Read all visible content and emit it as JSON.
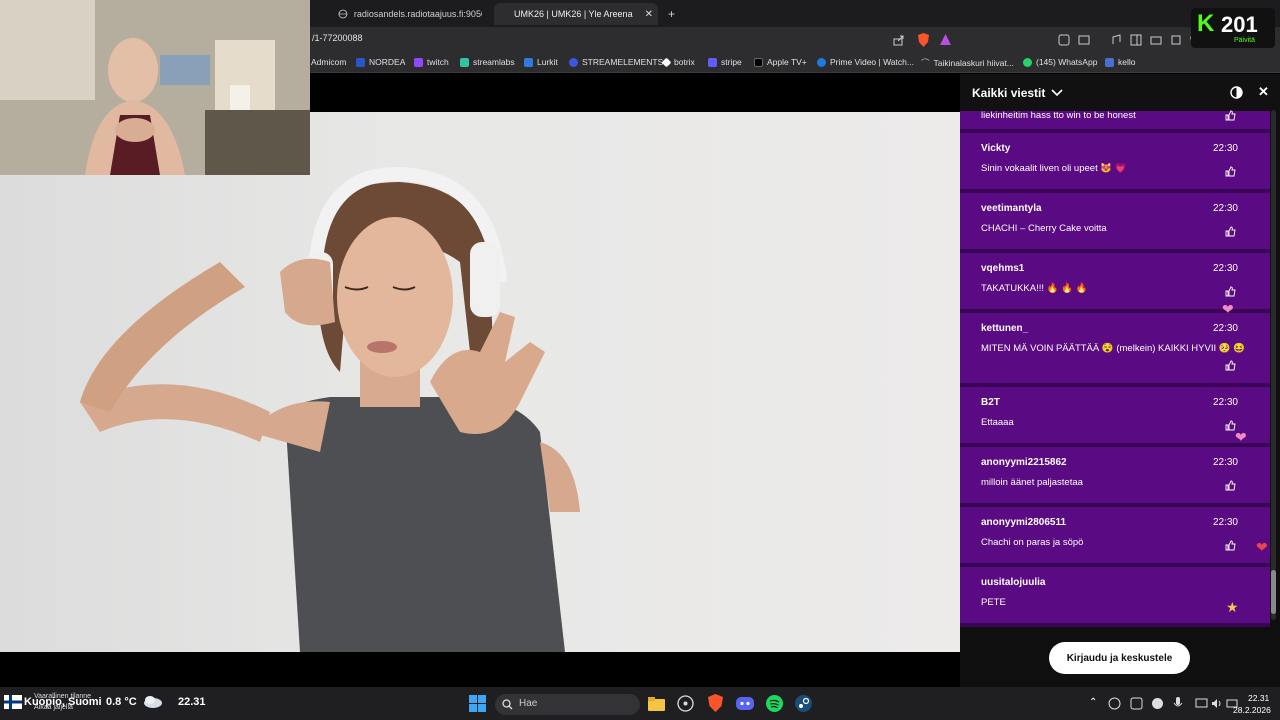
{
  "browser": {
    "tabs": [
      {
        "label": "radiosandels.radiotaajuus.fi:9050/rad"
      },
      {
        "label": "UMK26 | UMK26 | Yle Areena"
      }
    ],
    "new_tab": "+",
    "url": "/1-77200088",
    "bookmarks": [
      {
        "label": "Admicom",
        "color": "#ffffff"
      },
      {
        "label": "NORDEA",
        "color": "#2b56c9"
      },
      {
        "label": "twitch",
        "color": "#9146ff"
      },
      {
        "label": "streamlabs",
        "color": "#31c3a2"
      },
      {
        "label": "Lurkit",
        "color": "#2f7be0"
      },
      {
        "label": "STREAMELEMENTS",
        "color": "#3c55e3"
      },
      {
        "label": "botrix",
        "color": "#ffffff"
      },
      {
        "label": "stripe",
        "color": "#635bff"
      },
      {
        "label": "Apple TV+",
        "color": "#000000"
      },
      {
        "label": "Prime Video | Watch...",
        "color": "#1f7ae0"
      },
      {
        "label": "Taikinalaskuri hiivat...",
        "color": "#888888"
      },
      {
        "label": "(145) WhatsApp",
        "color": "#25d366"
      },
      {
        "label": "kello",
        "color": "#4a6fd1"
      }
    ]
  },
  "overlay": {
    "k_letter": "K",
    "k_count": "201",
    "k_sub": "Päivitä"
  },
  "chat": {
    "title": "Kaikki viestit",
    "partial_text": "liekinheitim hass tto win to be honest",
    "messages": [
      {
        "user": "Vickty",
        "time": "22:30",
        "text": "Sinin vokaalit liven oli upeet 😻 💗"
      },
      {
        "user": "veetimantyla",
        "time": "22:30",
        "text": "CHACHI – Cherry Cake voitta"
      },
      {
        "user": "vqehms1",
        "time": "22:30",
        "text": "TAKATUKKA!!! 🔥 🔥 🔥"
      },
      {
        "user": "kettunen_",
        "time": "22:30",
        "text": "MITEN MÄ VOIN PÄÄTTÄÄ 😵 (melkein) KAIKKI HYVII 🥺 😆"
      },
      {
        "user": "B2T",
        "time": "22:30",
        "text": "Ettaaaa"
      },
      {
        "user": "anonyymi2215862",
        "time": "22:30",
        "text": "milloin äänet paljastetaa"
      },
      {
        "user": "anonyymi2806511",
        "time": "22:30",
        "text": "Chachi on paras ja söpö"
      },
      {
        "user": "uusitalojuulia",
        "time": "",
        "text": "PETE"
      }
    ],
    "login_button": "Kirjaudu ja keskustele"
  },
  "taskbar": {
    "weather_overlay": "Vaarallinen tilanne",
    "weather_sub": "Aikaa jäljellä",
    "location": "Kuopio, Suomi",
    "temperature": "0.8 °C",
    "clock_overlay": "22.31",
    "search_placeholder": "Hae",
    "time": "22.31",
    "date": "28.2.2026"
  },
  "colors": {
    "chat_message_bg": "#5a0a82",
    "browser_chrome": "#2d2d30",
    "taskbar": "#1f1f22"
  }
}
